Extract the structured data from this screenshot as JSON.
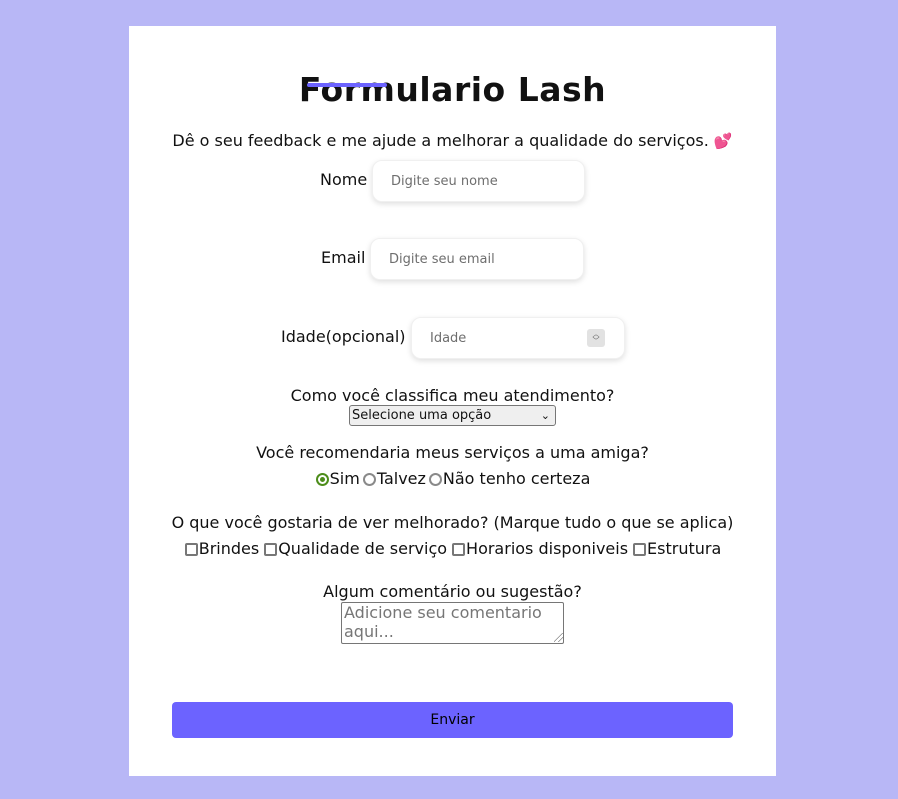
{
  "form": {
    "title": "Formulario Lash",
    "subtitle": "Dê o seu feedback e me ajude a melhorar a qualidade do serviços.",
    "subtitle_emoji": "💕",
    "name": {
      "label": "Nome",
      "placeholder": "Digite seu nome"
    },
    "email": {
      "label": "Email",
      "placeholder": "Digite seu email"
    },
    "age": {
      "label": "Idade(opcional)",
      "placeholder": "Idade"
    },
    "rating": {
      "question": "Como você classifica meu atendimento?",
      "selected": "Selecione uma opção"
    },
    "recommend": {
      "question": "Você recomendaria meus serviços a uma amiga?",
      "options": [
        "Sim",
        "Talvez",
        "Não tenho certeza"
      ],
      "selected": "Sim"
    },
    "improve": {
      "question": "O que você gostaria de ver melhorado? (Marque tudo o que se aplica)",
      "options": [
        "Brindes",
        "Qualidade de serviço",
        "Horarios disponiveis",
        "Estrutura"
      ]
    },
    "comment": {
      "question": "Algum comentário ou sugestão?",
      "placeholder": "Adicione seu comentario aqui..."
    },
    "submit_label": "Enviar"
  },
  "colors": {
    "page_background": "#b8b7f6",
    "card_background": "#ffffff",
    "accent": "#6c63ff",
    "radio_checked": "#4d8d1b"
  },
  "icons": {
    "select_arrow": "chevron-down-icon",
    "number_spinner": "spinner-arrows-icon"
  }
}
